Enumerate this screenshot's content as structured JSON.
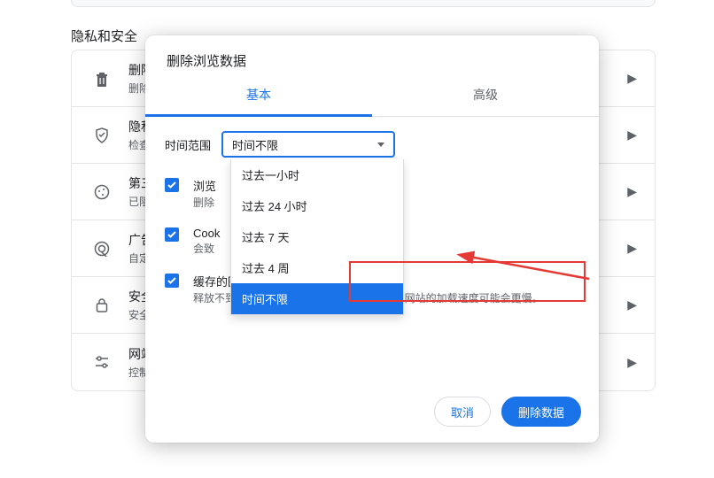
{
  "section_title": "隐私和安全",
  "rows": [
    {
      "icon": "trash",
      "title": "删除",
      "sub": "删除"
    },
    {
      "icon": "sliders",
      "title": "隐私",
      "sub": "检查"
    },
    {
      "icon": "cookie",
      "title": "第三",
      "sub": "已阻"
    },
    {
      "icon": "target",
      "title": "广告",
      "sub": "自定"
    },
    {
      "icon": "lock",
      "title": "安全",
      "sub": "安全"
    },
    {
      "icon": "tune",
      "title": "网站",
      "sub": "控制"
    }
  ],
  "arrow_glyph": "▶",
  "dialog": {
    "title": "删除浏览数据",
    "tabs": {
      "basic": "基本",
      "advanced": "高级"
    },
    "time_range_label": "时间范围",
    "select_value": "时间不限",
    "dropdown": [
      "过去一小时",
      "过去 24 小时",
      "过去 7 天",
      "过去 4 周",
      "时间不限"
    ],
    "selected_index": 4,
    "items": [
      {
        "title": "浏览",
        "sub": "删除"
      },
      {
        "title": "Cook",
        "sub": "会致"
      },
      {
        "title": "缓存的图片和文件",
        "sub": "释放不到 1 MB 空间。当您下次访问时，某些网站的加载速度可能会更慢。"
      }
    ],
    "buttons": {
      "cancel": "取消",
      "confirm": "删除数据"
    }
  }
}
